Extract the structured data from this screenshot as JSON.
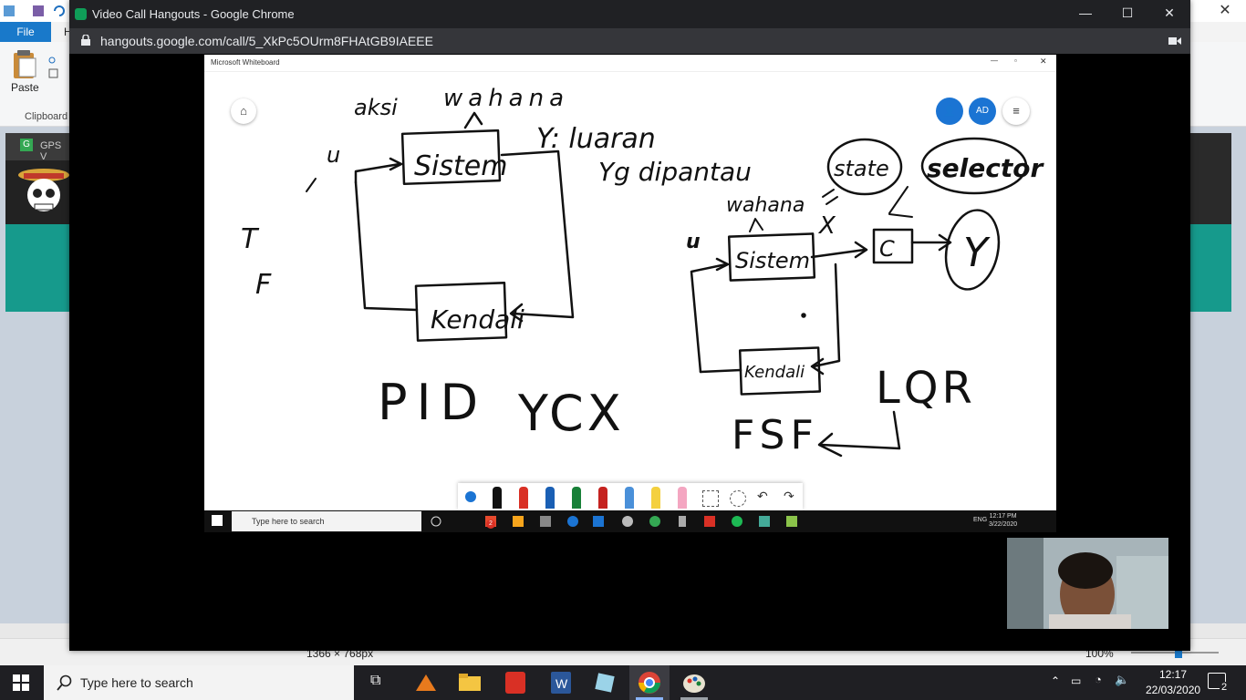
{
  "paint": {
    "file_tab": "File",
    "paste_label": "Paste",
    "clipboard_label": "Clipboard",
    "home_tab_fragment": "H",
    "dims_status": "1366 × 768px",
    "zoom_status": "100%",
    "bg_tab_text": "GPS V"
  },
  "chrome": {
    "title": "Video Call Hangouts - Google Chrome",
    "url": "hangouts.google.com/call/5_XkPc5OUrm8FHAtGB9IAEEE"
  },
  "whiteboard": {
    "app_title": "Microsoft Whiteboard",
    "avatar_initials": "AD",
    "handwriting": {
      "aksi": "aksi",
      "wahana_top": "wahana",
      "sistem_left": "Sistem",
      "kendali_left": "Kendali",
      "y_luaran": "Y: luaran",
      "yg_dipantau": "Yg dipantau",
      "u_left": "u",
      "t_left": "T",
      "f_left": "F",
      "wahana_right": "wahana",
      "state": "state",
      "selector": "selector",
      "x_mark": "X",
      "u_right": "u",
      "sistem_right": "Sistem",
      "c_block": "C",
      "y_block": "Y",
      "kendali_right": "Kendali",
      "pid": "PID",
      "ycx": "YCX",
      "lqr": "LQR",
      "fsf": "FSF"
    },
    "remote_taskbar": {
      "search_placeholder": "Type here to search",
      "lang": "ENG",
      "time": "12:17 PM",
      "date": "3/22/2020",
      "badge": "2"
    }
  },
  "taskbar": {
    "search_placeholder": "Type here to search",
    "time": "12:17",
    "date": "22/03/2020",
    "notifications": "2"
  },
  "colors": {
    "chrome_dark": "#202124",
    "win_blue": "#1979ca",
    "wb_blue": "#1b74d3",
    "teal": "#169a8c"
  }
}
